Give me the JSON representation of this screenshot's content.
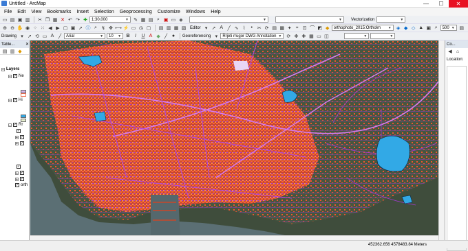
{
  "window": {
    "title": "Untitled - ArcMap",
    "minimize": "—",
    "maximize": "☐",
    "close": "✕"
  },
  "menu": [
    "File",
    "Edit",
    "View",
    "Bookmarks",
    "Insert",
    "Selection",
    "Geoprocessing",
    "Customize",
    "Windows",
    "Help"
  ],
  "toolbar1": {
    "scale": "1:30,000",
    "vectorization_label": "Vectorization"
  },
  "toolbar2": {
    "editor_label": "Editor",
    "raster_layer": "orthophoto_2015:Ortholm",
    "zoom_value": "500"
  },
  "toolbar3": {
    "drawing_label": "Drawing",
    "font_name": "Arial",
    "font_size": "10",
    "bold": "B",
    "italic": "I",
    "underline": "U",
    "georeferencing_label": "Georeferencing",
    "georef_layer": "Rrjeti rrugor DWG Annotation"
  },
  "toc": {
    "title": "Table...",
    "layers_label": "Layers",
    "items": [
      {
        "label": "Ne",
        "checked": true
      },
      {
        "label": "Hi",
        "checked": true
      },
      {
        "label": "Rr",
        "checked": true
      },
      {
        "label": "orth",
        "checked": true
      }
    ]
  },
  "right_panel": {
    "title": "Co...",
    "location_label": "Location:"
  },
  "status": {
    "coords": "452362.656  4578483.84 Meters"
  },
  "colors": {
    "roads": "#b03ad6",
    "buildings": "#f2552f",
    "water": "#32a9e6",
    "imagery_dark": "#3e4a3f",
    "sea": "#5b6f74"
  }
}
